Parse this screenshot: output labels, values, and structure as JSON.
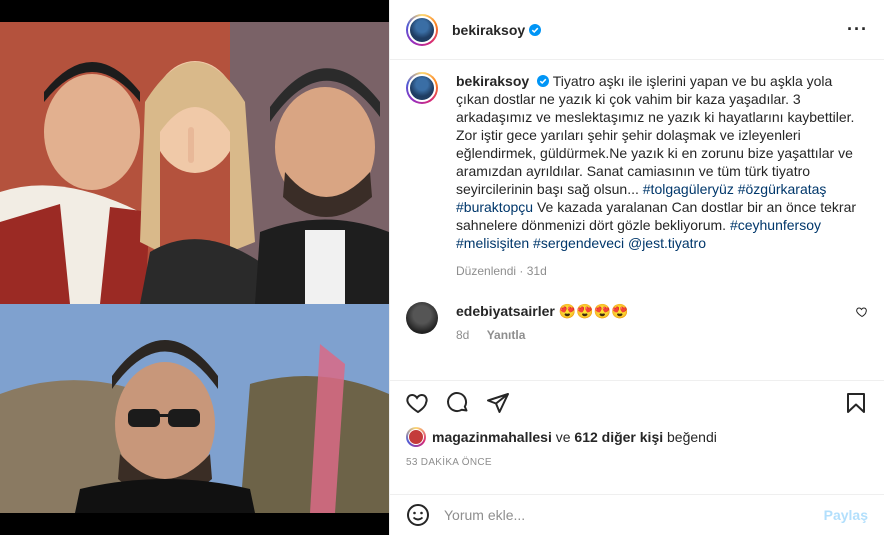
{
  "post": {
    "username": "bekiraksoy",
    "caption": {
      "username": "bekiraksoy",
      "text_1": "Tiyatro aşkı ile işlerini yapan ve bu aşkla yola çıkan dostlar ne yazık ki çok vahim bir kaza yaşadılar. 3 arkadaşımız ve meslektaşımız ne yazık ki hayatlarını kaybettiler. Zor iştir gece yarıları şehir şehir dolaşmak ve izleyenleri eğlendirmek, güldürmek.Ne yazık ki en zorunu bize yaşattılar ve aramızdan ayrıldılar. Sanat camiasının ve tüm türk tiyatro seyircilerinin başı sağ olsun...",
      "tag_1": "#tolgagüleryüz",
      "tag_2": "#özgürkarataş",
      "tag_3": "#buraktopçu",
      "text_2": "Ve kazada yaralanan Can dostlar bir an önce tekrar sahnelere dönmenizi dört gözle bekliyorum.",
      "tag_4": "#ceyhunfersoy",
      "tag_5": "#melisişiten",
      "tag_6": "#sergendeveci",
      "tag_7": "@jest.tiyatro",
      "edited": "Düzenlendi",
      "age": "31d"
    },
    "comment": {
      "username": "edebiyatsairler",
      "text": "😍😍😍😍",
      "age": "8d",
      "reply_label": "Yanıtla"
    },
    "likes": {
      "first_user": "magazinmahallesi",
      "and": "ve",
      "others": "612 diğer kişi",
      "suffix": "beğendi"
    },
    "timestamp": "53 DAKİKA ÖNCE",
    "add_comment": {
      "placeholder": "Yorum ekle...",
      "post_label": "Paylaş"
    }
  },
  "icons": {
    "verified": "verified-badge-icon",
    "more": "more-options-icon",
    "like": "heart-icon",
    "comment": "comment-icon",
    "share": "share-icon",
    "save": "bookmark-icon",
    "emoji": "emoji-icon"
  },
  "colors": {
    "link": "#00376b",
    "verified": "#0095f6",
    "muted": "#8e8e8e",
    "post_disabled": "#b2dffc"
  }
}
